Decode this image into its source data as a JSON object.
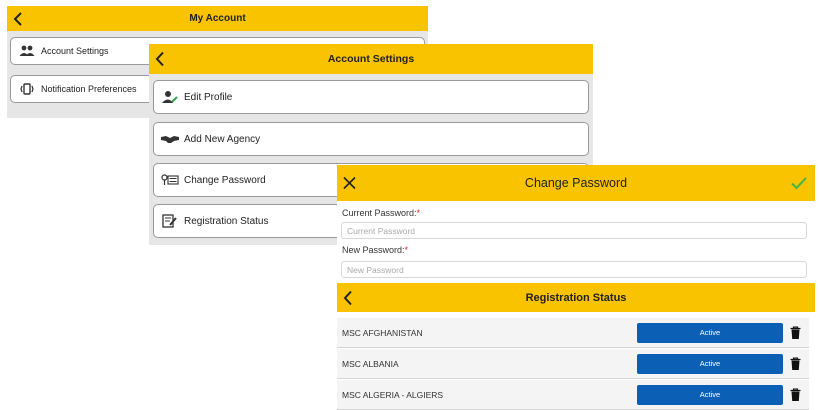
{
  "my_account": {
    "title": "My Account",
    "items": [
      {
        "label": "Account Settings",
        "icon": "users-icon"
      },
      {
        "label": "Notification Preferences",
        "icon": "vibrate-phone-icon"
      }
    ]
  },
  "account_settings": {
    "title": "Account Settings",
    "items": [
      {
        "label": "Edit Profile",
        "icon": "user-edit-icon"
      },
      {
        "label": "Add New Agency",
        "icon": "handshake-icon"
      },
      {
        "label": "Change Password",
        "icon": "key-icon"
      },
      {
        "label": "Registration Status",
        "icon": "document-edit-icon"
      }
    ]
  },
  "change_password": {
    "title": "Change Password",
    "current_label": "Current Password:",
    "current_placeholder": "Current Password",
    "new_label": "New Password:",
    "new_placeholder": "New Password",
    "required_mark": "*"
  },
  "registration_status": {
    "title": "Registration Status",
    "rows": [
      {
        "name": "MSC AFGHANISTAN",
        "status": "Active"
      },
      {
        "name": "MSC ALBANIA",
        "status": "Active"
      },
      {
        "name": "MSC ALGERIA - ALGIERS",
        "status": "Active"
      }
    ]
  },
  "colors": {
    "header": "#f9c300",
    "status_button": "#0b5fb5",
    "check": "#44b54a",
    "required": "#e0201b"
  }
}
